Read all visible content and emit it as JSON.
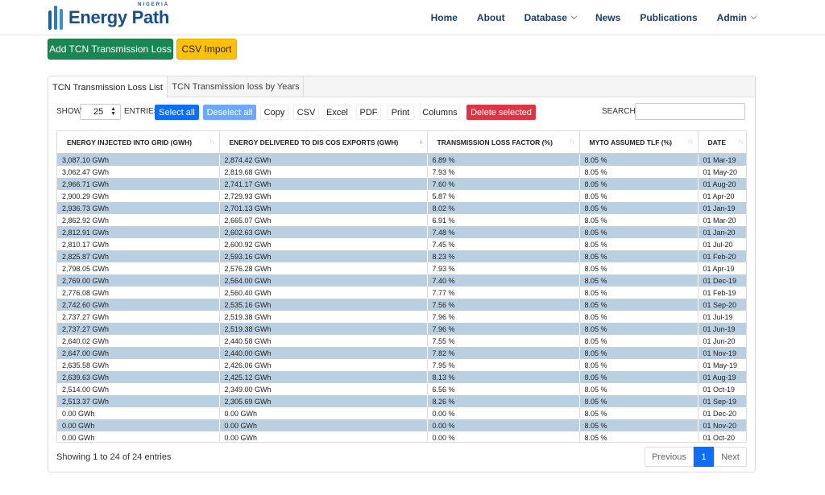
{
  "brand": {
    "name": "Energy Path",
    "tagline": "NIGERIA"
  },
  "nav": [
    {
      "label": "Home",
      "dropdown": false
    },
    {
      "label": "About",
      "dropdown": false
    },
    {
      "label": "Database",
      "dropdown": true
    },
    {
      "label": "News",
      "dropdown": false
    },
    {
      "label": "Publications",
      "dropdown": false
    },
    {
      "label": "Admin",
      "dropdown": true
    }
  ],
  "actions": {
    "add_label": "Add TCN Transmission Loss",
    "import_label": "CSV Import"
  },
  "tabs": [
    {
      "label": "TCN Transmission Loss List",
      "active": true
    },
    {
      "label": "TCN Transmission loss by Years",
      "active": false
    }
  ],
  "toolbar": {
    "show_label": "SHOW",
    "page_size": "25",
    "entries_label": "ENTRIES",
    "select_all": "Select all",
    "deselect_all": "Deselect all",
    "copy": "Copy",
    "csv": "CSV",
    "excel": "Excel",
    "pdf": "PDF",
    "print": "Print",
    "columns": "Columns",
    "delete_selected": "Delete selected",
    "search_label": "SEARCH:",
    "search_value": ""
  },
  "table": {
    "columns": [
      "ENERGY INJECTED INTO GRID (GWH)",
      "ENERGY DELIVERED TO DIS COS EXPORTS (GWH)",
      "TRANSMISSION LOSS FACTOR (%)",
      "MYTO ASSUMED TLF (%)",
      "DATE"
    ],
    "sorted_column": 1,
    "rows": [
      [
        "3,087.10 GWh",
        "2,874.42 GWh",
        "6.89 %",
        "8.05 %",
        "01 Mar-19"
      ],
      [
        "3,062.47 GWh",
        "2,819.68 GWh",
        "7.93 %",
        "8.05 %",
        "01 May-20"
      ],
      [
        "2,966.71 GWh",
        "2,741.17 GWh",
        "7.60 %",
        "8.05 %",
        "01 Aug-20"
      ],
      [
        "2,900.29 GWh",
        "2,729.93 GWh",
        "5.87 %",
        "8.05 %",
        "01 Apr-20"
      ],
      [
        "2,936.73 GWh",
        "2,701.13 GWh",
        "8.02 %",
        "8.05 %",
        "01 Jan-19"
      ],
      [
        "2,862.92 GWh",
        "2,665.07 GWh",
        "6.91 %",
        "8.05 %",
        "01 Mar-20"
      ],
      [
        "2,812.91 GWh",
        "2,602.63 GWh",
        "7.48 %",
        "8.05 %",
        "01 Jan-20"
      ],
      [
        "2,810.17 GWh",
        "2,600.92 GWh",
        "7.45 %",
        "8.05 %",
        "01 Jul-20"
      ],
      [
        "2,825.87 GWh",
        "2,593.16 GWh",
        "8.23 %",
        "8.05 %",
        "01 Feb-20"
      ],
      [
        "2,798.05 GWh",
        "2,576.28 GWh",
        "7.93 %",
        "8.05 %",
        "01 Apr-19"
      ],
      [
        "2,769.00 GWh",
        "2,564.00 GWh",
        "7.40 %",
        "8.05 %",
        "01 Dec-19"
      ],
      [
        "2,776.08 GWh",
        "2,560.40 GWh",
        "7.77 %",
        "8.05 %",
        "01 Feb-19"
      ],
      [
        "2,742.60 GWh",
        "2,535.16 GWh",
        "7.56 %",
        "8.05 %",
        "01 Sep-20"
      ],
      [
        "2,737.27 GWh",
        "2,519.38 GWh",
        "7.96 %",
        "8.05 %",
        "01 Jul-19"
      ],
      [
        "2,737.27 GWh",
        "2,519.38 GWh",
        "7.96 %",
        "8.05 %",
        "01 Jun-19"
      ],
      [
        "2,640.02 GWh",
        "2,440.58 GWh",
        "7.55 %",
        "8.05 %",
        "01 Jun-20"
      ],
      [
        "2,647.00 GWh",
        "2,440.00 GWh",
        "7.82 %",
        "8.05 %",
        "01 Nov-19"
      ],
      [
        "2,635.58 GWh",
        "2,426.06 GWh",
        "7.95 %",
        "8.05 %",
        "01 May-19"
      ],
      [
        "2,639.63 GWh",
        "2,425.12 GWh",
        "8.13 %",
        "8.05 %",
        "01 Aug-19"
      ],
      [
        "2,514.00 GWh",
        "2,349.00 GWh",
        "6.56 %",
        "8.05 %",
        "01 Oct-19"
      ],
      [
        "2,513.37 GWh",
        "2,305.69 GWh",
        "8.26 %",
        "8.05 %",
        "01 Sep-19"
      ],
      [
        "0.00 GWh",
        "0.00 GWh",
        "0.00 %",
        "8.05 %",
        "01 Dec-20"
      ],
      [
        "0.00 GWh",
        "0.00 GWh",
        "0.00 %",
        "8.05 %",
        "01 Nov-20"
      ],
      [
        "0.00 GWh",
        "0.00 GWh",
        "0.00 %",
        "8.05 %",
        "01 Oct-20"
      ]
    ]
  },
  "footer": {
    "info": "Showing 1 to 24 of 24 entries",
    "previous": "Previous",
    "current_page": "1",
    "next": "Next"
  },
  "colors": {
    "primary_green": "#198754",
    "warning_yellow": "#ffc107",
    "primary_blue": "#0d6efd",
    "light_blue": "#6ea8fe",
    "danger_red": "#dc3545",
    "row_highlight": "#b9cfe2",
    "brand_blue": "#1b4f86"
  }
}
